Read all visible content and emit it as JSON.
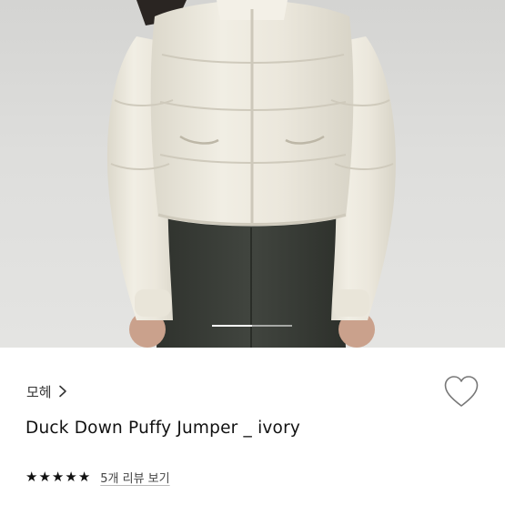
{
  "product": {
    "brand": "모헤",
    "name": "Duck Down Puffy Jumper _ ivory",
    "rating": 5,
    "stars": [
      "★",
      "★",
      "★",
      "★",
      "★"
    ],
    "review_link": "5개 리뷰 보기",
    "image_pager_progress": 0.5
  },
  "icons": {
    "brand_chevron": "chevron-right-icon",
    "wishlist": "heart-outline-icon"
  },
  "colors": {
    "jacket": "#ece8dc",
    "pants": "#3a3d37",
    "background": "#d9d9d7"
  }
}
